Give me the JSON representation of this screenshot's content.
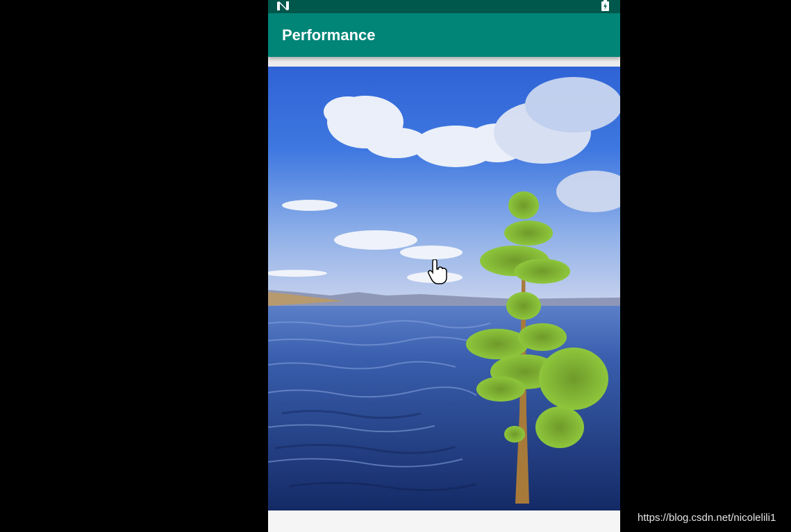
{
  "app": {
    "title": "Performance"
  },
  "status_bar": {
    "left_icon": "notification-n-icon",
    "right_icon": "battery-charging-icon"
  },
  "image": {
    "subject": "lake-landscape-photo"
  },
  "cursor": {
    "icon": "hand-pointer-cursor-icon"
  },
  "watermark": {
    "text": "https://blog.csdn.net/nicolelili1"
  },
  "colors": {
    "status_bar": "#00574b",
    "app_bar": "#008577",
    "background": "#000000"
  }
}
